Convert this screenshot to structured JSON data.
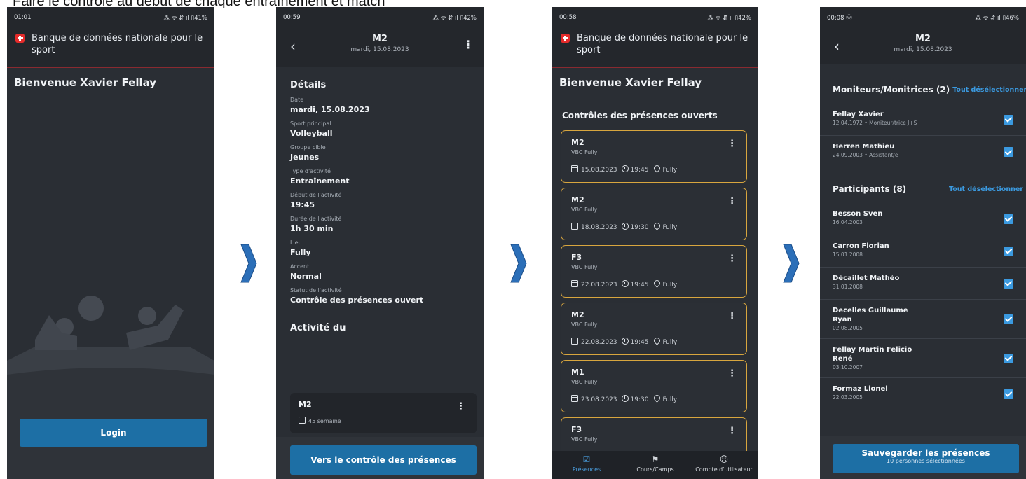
{
  "caption": "Faire le contrôle au début de chaque entraînement et match",
  "colors": {
    "accent": "#1d6fa5",
    "highlight": "#d8a63e",
    "link": "#3b9ae0",
    "background": "#2a2e34"
  },
  "screen1": {
    "status_time": "01:01",
    "status_icons": "⁂ ᯤ ⇵ ıl ▯41%",
    "brand": "Banque de données nationale pour le sport",
    "welcome": "Bienvenue Xavier Fellay",
    "login_button": "Login"
  },
  "screen2": {
    "status_time": "00:59",
    "status_icons": "⁂ ᯤ ⇵ ıl ▯42%",
    "title": "M2",
    "subtitle": "mardi, 15.08.2023",
    "details_heading": "Détails",
    "fields": [
      {
        "label": "Date",
        "value": "mardi, 15.08.2023"
      },
      {
        "label": "Sport principal",
        "value": "Volleyball"
      },
      {
        "label": "Groupe cible",
        "value": "Jeunes"
      },
      {
        "label": "Type d'activité",
        "value": "Entraînement"
      },
      {
        "label": "Début de l'activité",
        "value": "19:45"
      },
      {
        "label": "Durée de l'activité",
        "value": "1h 30 min"
      },
      {
        "label": "Lieu",
        "value": "Fully"
      },
      {
        "label": "Accent",
        "value": "Normal"
      },
      {
        "label": "Statut de l'activité",
        "value": "Contrôle des présences ouvert"
      }
    ],
    "activity_heading": "Activité du",
    "activity_card": {
      "title": "M2",
      "meta": "45 semaine"
    },
    "button": "Vers le contrôle des présences"
  },
  "screen3": {
    "status_time": "00:58",
    "status_icons": "⁂ ᯤ ⇵ ıl ▯42%",
    "brand": "Banque de données nationale pour le sport",
    "welcome": "Bienvenue Xavier Fellay",
    "section_title": "Contrôles des présences ouverts",
    "cards": [
      {
        "title": "M2",
        "club": "VBC Fully",
        "date": "15.08.2023",
        "time": "19:45",
        "place": "Fully"
      },
      {
        "title": "M2",
        "club": "VBC Fully",
        "date": "18.08.2023",
        "time": "19:30",
        "place": "Fully"
      },
      {
        "title": "F3",
        "club": "VBC Fully",
        "date": "22.08.2023",
        "time": "19:45",
        "place": "Fully"
      },
      {
        "title": "M2",
        "club": "VBC Fully",
        "date": "22.08.2023",
        "time": "19:45",
        "place": "Fully"
      },
      {
        "title": "M1",
        "club": "VBC Fully",
        "date": "23.08.2023",
        "time": "19:30",
        "place": "Fully"
      },
      {
        "title": "F3",
        "club": "VBC Fully",
        "date": "",
        "time": "",
        "place": ""
      }
    ],
    "bottom_nav": [
      {
        "label": "Présences",
        "icon": "checklist-icon"
      },
      {
        "label": "Cours/Camps",
        "icon": "courses-icon"
      },
      {
        "label": "Compte d'utilisateur",
        "icon": "account-icon"
      }
    ]
  },
  "screen4": {
    "status_time": "00:08 ⓦ",
    "status_icons": "⁂ ᯤ ⇵ ıl ▯46%",
    "title": "M2",
    "subtitle": "mardi, 15.08.2023",
    "leaders_title": "Moniteurs/Monitrices (2)",
    "leaders_link": "Tout désélectionner",
    "leaders": [
      {
        "name": "Fellay Xavier",
        "sub": "12.04.1972 • Moniteur/trice J+S"
      },
      {
        "name": "Herren Mathieu",
        "sub": "24.09.2003 • Assistant/e"
      }
    ],
    "participants_title": "Participants (8)",
    "participants_link": "Tout désélectionner",
    "participants": [
      {
        "name": "Besson Sven",
        "sub": "16.04.2003"
      },
      {
        "name": "Carron Florian",
        "sub": "15.01.2008"
      },
      {
        "name": "Décaillet Mathéo",
        "sub": "31.01.2008"
      },
      {
        "name": "Decelles Guillaume Ryan",
        "sub": "02.08.2005"
      },
      {
        "name": "Fellay Martin Felicio René",
        "sub": "03.10.2007"
      },
      {
        "name": "Formaz Lionel",
        "sub": "22.03.2005"
      }
    ],
    "save_button": "Sauvegarder les présences",
    "save_sub": "10 personnes sélectionnées"
  }
}
